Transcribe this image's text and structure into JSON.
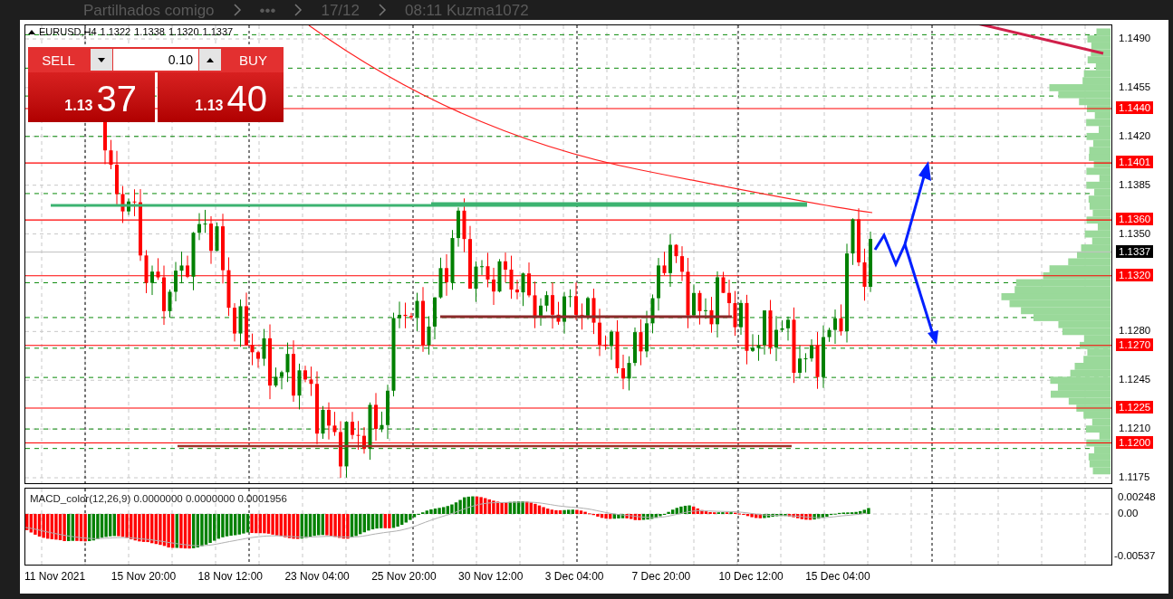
{
  "top_bar": {
    "items": [
      "Partilhados comigo",
      "•••",
      "17/12",
      "08:11 Kuzma1072"
    ]
  },
  "chart": {
    "legend": {
      "symbol": "EURUSD,H4",
      "ohlc": [
        "1.1322",
        "1.1338",
        "1.1320",
        "1.1337"
      ]
    },
    "trade_panel": {
      "sell_label": "SELL",
      "buy_label": "BUY",
      "volume": "0.10",
      "sell_price": {
        "prefix": "1.13",
        "pips": "37"
      },
      "buy_price": {
        "prefix": "1.13",
        "pips": "40"
      }
    },
    "price_axis": [
      {
        "label": "1.1490",
        "kind": "tick"
      },
      {
        "label": "1.1455",
        "kind": "tick"
      },
      {
        "label": "1.1440",
        "kind": "level"
      },
      {
        "label": "1.1420",
        "kind": "tick"
      },
      {
        "label": "1.1401",
        "kind": "level"
      },
      {
        "label": "1.1385",
        "kind": "tick"
      },
      {
        "label": "1.1360",
        "kind": "level"
      },
      {
        "label": "1.1350",
        "kind": "tick"
      },
      {
        "label": "1.1337",
        "kind": "current"
      },
      {
        "label": "1.1320",
        "kind": "level"
      },
      {
        "label": "1.1280",
        "kind": "tick"
      },
      {
        "label": "1.1270",
        "kind": "level"
      },
      {
        "label": "1.1245",
        "kind": "tick"
      },
      {
        "label": "1.1225",
        "kind": "level"
      },
      {
        "label": "1.1210",
        "kind": "tick"
      },
      {
        "label": "1.1200",
        "kind": "level"
      },
      {
        "label": "1.1175",
        "kind": "tick"
      }
    ],
    "macd": {
      "label": "MACD_color(12,26,9) 0.0000000 0.0000000 0.0001956",
      "scale": [
        "0.00248",
        "0.00",
        "-0.00537"
      ]
    },
    "time_axis": [
      "11 Nov 2021",
      "15 Nov 20:00",
      "18 Nov 12:00",
      "23 Nov 04:00",
      "25 Nov 20:00",
      "30 Nov 12:00",
      "3 Dec 04:00",
      "7 Dec 20:00",
      "10 Dec 12:00",
      "15 Dec 04:00"
    ]
  }
}
